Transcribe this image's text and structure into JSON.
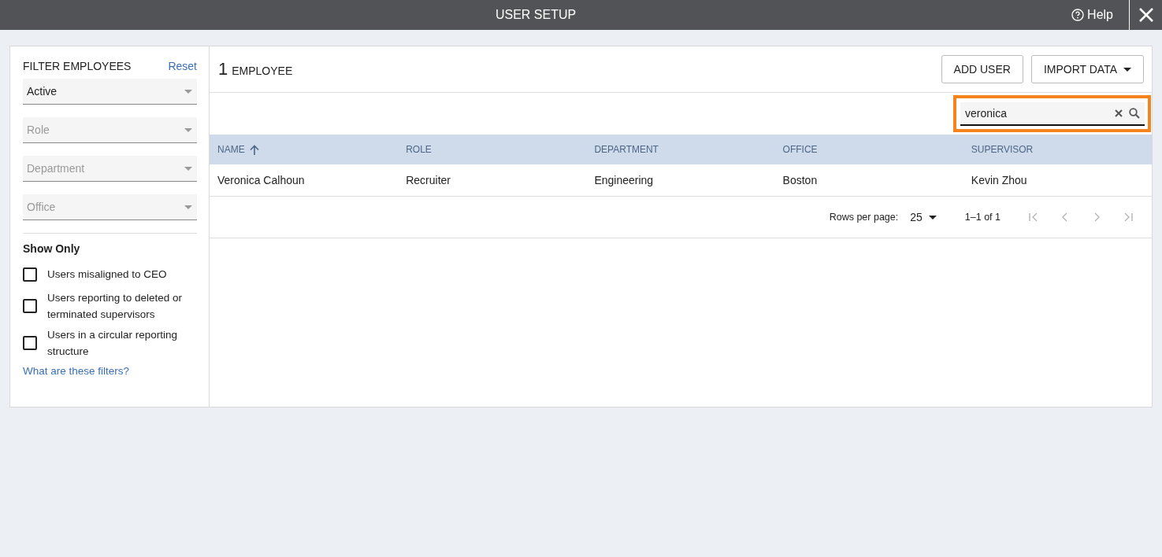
{
  "window": {
    "title": "USER SETUP",
    "help": "Help"
  },
  "filters": {
    "title": "FILTER EMPLOYEES",
    "reset": "Reset",
    "selects": [
      {
        "value": "Active"
      },
      {
        "placeholder": "Role"
      },
      {
        "placeholder": "Department"
      },
      {
        "placeholder": "Office"
      }
    ],
    "show_only": "Show Only",
    "checkboxes": [
      {
        "label": "Users misaligned to CEO",
        "checked": false
      },
      {
        "label": "Users reporting to deleted or terminated supervisors",
        "checked": false
      },
      {
        "label": "Users in a circular reporting structure",
        "checked": false
      }
    ],
    "help_link": "What are these filters?"
  },
  "main": {
    "count": "1",
    "count_label": "EMPLOYEE",
    "buttons": [
      {
        "label": "ADD USER",
        "kind": "plain"
      },
      {
        "label": "IMPORT DATA",
        "kind": "menu"
      }
    ],
    "search": {
      "value": "veronica",
      "highlighted": true
    },
    "table": {
      "columns": [
        {
          "label": "NAME",
          "sorted": true
        },
        {
          "label": "ROLE",
          "sorted": false
        },
        {
          "label": "DEPARTMENT",
          "sorted": false
        },
        {
          "label": "OFFICE",
          "sorted": false
        },
        {
          "label": "SUPERVISOR",
          "sorted": false
        }
      ],
      "rows": [
        [
          "Veronica Calhoun",
          "Recruiter",
          "Engineering",
          "Boston",
          "Kevin Zhou"
        ]
      ]
    },
    "pagination": {
      "rows_per_page_label": "Rows per page:",
      "rows_per_page": "25",
      "range": "1–1 of 1",
      "nav": [
        {
          "kind": "first",
          "disabled": true
        },
        {
          "kind": "prev",
          "disabled": true
        },
        {
          "kind": "next",
          "disabled": true
        },
        {
          "kind": "last",
          "disabled": true
        }
      ]
    }
  }
}
